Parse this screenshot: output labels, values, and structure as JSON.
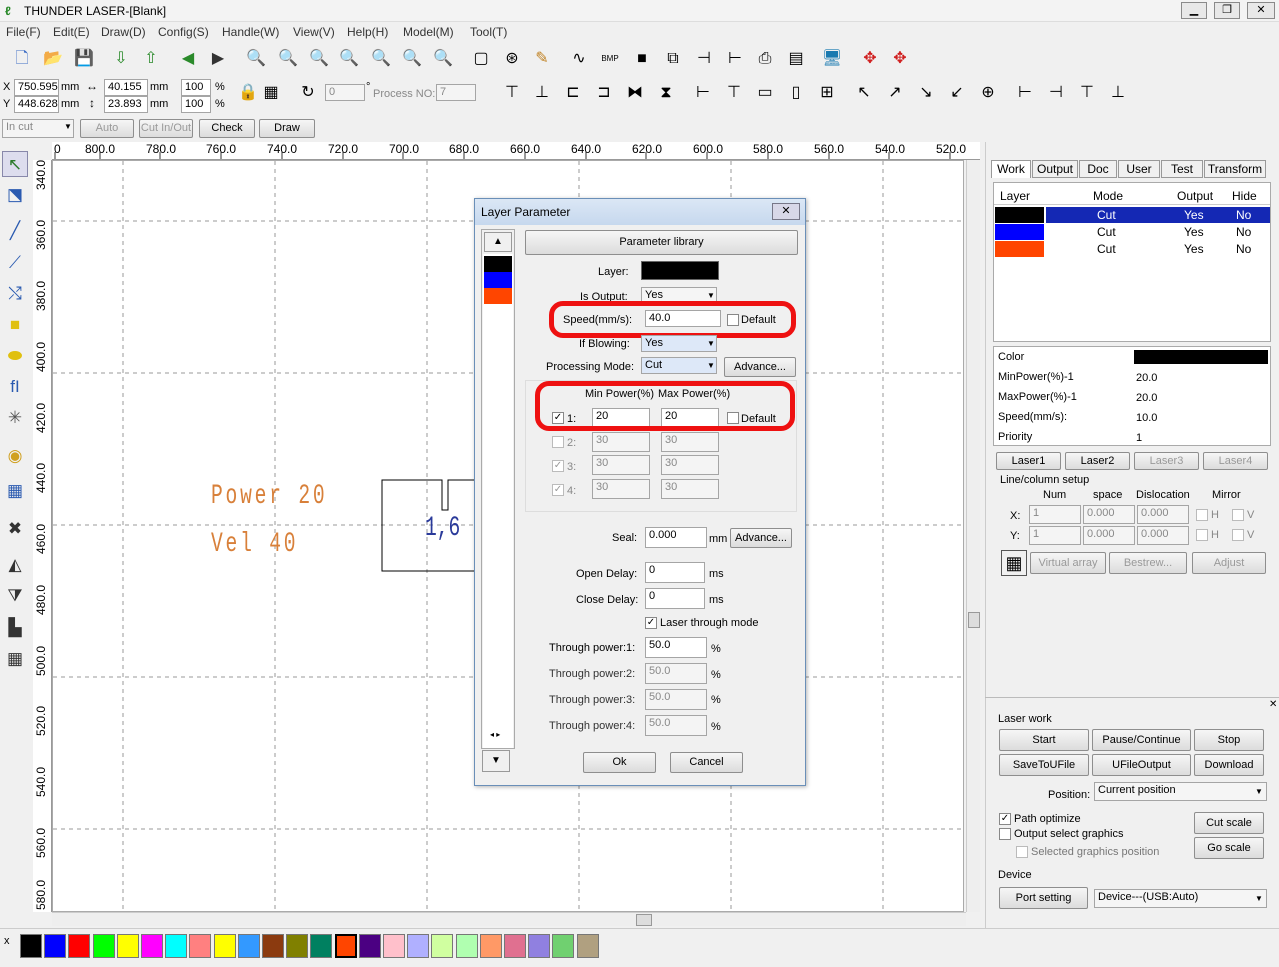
{
  "window": {
    "title": "THUNDER LASER-[Blank]",
    "min": "▁",
    "max": "❐",
    "close": "✕"
  },
  "menu": [
    "File(F)",
    "Edit(E)",
    "Draw(D)",
    "Config(S)",
    "Handle(W)",
    "View(V)",
    "Help(H)",
    "Model(M)",
    "Tool(T)"
  ],
  "toolbar": {
    "bmp_label": "BMP"
  },
  "coords": {
    "x_label": "X",
    "y_label": "Y",
    "x": "750.595",
    "y": "448.628",
    "unit": "mm",
    "w": "40.155",
    "h": "23.893",
    "sx": "100",
    "sy": "100",
    "pct": "%",
    "rot": "0",
    "deg": "°",
    "process_no_label": "Process NO:",
    "process_no": "7"
  },
  "cutbar": {
    "mode": "In cut",
    "auto": "Auto",
    "cut_in_out": "Cut In/Out",
    "check": "Check",
    "draw": "Draw"
  },
  "ruler_h": [
    "0",
    "800.0",
    "780.0",
    "760.0",
    "740.0",
    "720.0",
    "700.0",
    "680.0",
    "660.0",
    "640.0",
    "620.0",
    "600.0",
    "580.0",
    "560.0",
    "540.0",
    "520.0"
  ],
  "ruler_v": [
    "340.0",
    "360.0",
    "380.0",
    "400.0",
    "420.0",
    "440.0",
    "460.0",
    "480.0",
    "500.0",
    "520.0",
    "540.0",
    "560.0",
    "580.0"
  ],
  "canvas_text": {
    "power": "Power 20",
    "vel": "Vel 40",
    "shape_text": "1,6"
  },
  "dialog": {
    "title": "Layer Parameter",
    "close": "✕",
    "param_library": "Parameter library",
    "layer_label": "Layer:",
    "is_output_label": "Is Output:",
    "is_output": "Yes",
    "speed_label": "Speed(mm/s):",
    "speed": "40.0",
    "default": "Default",
    "if_blowing_label": "If Blowing:",
    "if_blowing": "Yes",
    "proc_mode_label": "Processing Mode:",
    "proc_mode": "Cut",
    "advance": "Advance...",
    "min_power_hdr": "Min Power(%)",
    "max_power_hdr": "Max Power(%)",
    "power_rows": [
      {
        "label": "1:",
        "min": "20",
        "max": "20"
      },
      {
        "label": "2:",
        "min": "30",
        "max": "30"
      },
      {
        "label": "3:",
        "min": "30",
        "max": "30"
      },
      {
        "label": "4:",
        "min": "30",
        "max": "30"
      }
    ],
    "seal_label": "Seal:",
    "seal": "0.000",
    "mm": "mm",
    "open_delay_label": "Open Delay:",
    "open_delay": "0",
    "close_delay_label": "Close Delay:",
    "close_delay": "0",
    "ms": "ms",
    "laser_through": "Laser through mode",
    "through": [
      {
        "label": "Through power:1:",
        "value": "50.0"
      },
      {
        "label": "Through power:2:",
        "value": "50.0"
      },
      {
        "label": "Through power:3:",
        "value": "50.0"
      },
      {
        "label": "Through power:4:",
        "value": "50.0"
      }
    ],
    "ok": "Ok",
    "cancel": "Cancel"
  },
  "colors": {
    "black": "#000000",
    "blue": "#0000ff",
    "orange": "#ff4500",
    "dialog_red": "#ee1111"
  },
  "right": {
    "tabs": [
      "Work",
      "Output",
      "Doc",
      "User",
      "Test",
      "Transform"
    ],
    "layer_headers": [
      "Layer",
      "Mode",
      "Output",
      "Hide"
    ],
    "layers": [
      {
        "mode": "Cut",
        "output": "Yes",
        "hide": "No"
      },
      {
        "mode": "Cut",
        "output": "Yes",
        "hide": "No"
      },
      {
        "mode": "Cut",
        "output": "Yes",
        "hide": "No"
      }
    ],
    "props": [
      {
        "k": "Color",
        "v": ""
      },
      {
        "k": "MinPower(%)-1",
        "v": "20.0"
      },
      {
        "k": "MaxPower(%)-1",
        "v": "20.0"
      },
      {
        "k": "Speed(mm/s):",
        "v": "10.0"
      },
      {
        "k": "Priority",
        "v": "1"
      }
    ],
    "laser_tabs": [
      "Laser1",
      "Laser2",
      "Laser3",
      "Laser4"
    ],
    "line_col": "Line/column setup",
    "lc_headers": [
      "Num",
      "space",
      "Dislocation",
      "Mirror"
    ],
    "lc_x": {
      "label": "X:",
      "num": "1",
      "space": "0.000",
      "disl": "0.000",
      "m": "H",
      "m2": "V"
    },
    "lc_y": {
      "label": "Y:",
      "num": "1",
      "space": "0.000",
      "disl": "0.000",
      "m": "H",
      "m2": "V"
    },
    "virtual_array": "Virtual array",
    "bestrew": "Bestrew...",
    "adjust": "Adjust",
    "laser_work": "Laser work",
    "start": "Start",
    "pause": "Pause/Continue",
    "stop": "Stop",
    "save_u": "SaveToUFile",
    "ufile_out": "UFileOutput",
    "download": "Download",
    "position_label": "Position:",
    "position": "Current position",
    "path_opt": "Path optimize",
    "out_sel": "Output select graphics",
    "sel_pos": "Selected graphics position",
    "cut_scale": "Cut scale",
    "go_scale": "Go scale",
    "device": "Device",
    "port": "Port setting",
    "device_val": "Device---(USB:Auto)"
  },
  "palette": [
    "#000000",
    "#0000ff",
    "#ff0000",
    "#00ff00",
    "#ffff00",
    "#ff00ff",
    "#00ffff",
    "#ff8080",
    "#ffff00",
    "#3399ff",
    "#8b3a0f",
    "#808000",
    "#008060",
    "#ff4500",
    "#4b0082",
    "#ffc0cb",
    "#b0b0ff",
    "#d0ffa0",
    "#b0ffb0",
    "#ff9966",
    "#e07090",
    "#9080e0",
    "#70d070",
    "#b0a080"
  ],
  "palette_x": "x"
}
